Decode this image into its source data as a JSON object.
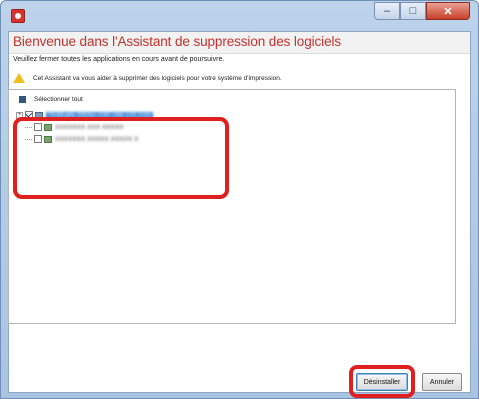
{
  "window": {
    "title": "",
    "caption_buttons": {
      "minimize": "–",
      "maximize": "□",
      "close": "✕"
    },
    "icon": "app-icon"
  },
  "wizard": {
    "heading": "Bienvenue dans l'Assistant de suppression des logiciels",
    "subtext": "Veuillez fermer toutes les applications en cours avant de poursuivre.",
    "info_icon": "warning-icon",
    "info_text": "Cet Assistant va vous aider à supprimer des logiciels pour votre système d'impression."
  },
  "list": {
    "select_all_label": "Sélectionner tout",
    "items": [
      {
        "label": "TASKalfa 2553ci (192.168.123.216)",
        "checked": true,
        "selected": true
      },
      {
        "label": "XXXXXXX XXX XXXXX",
        "checked": false,
        "selected": false
      },
      {
        "label": "XXXXXXX XXXXX XXXXX X",
        "checked": false,
        "selected": false
      }
    ]
  },
  "buttons": {
    "uninstall": "Désinstaller",
    "cancel": "Annuler"
  },
  "colors": {
    "heading": "#c3312c",
    "highlight": "#e0201e",
    "selection": "#3d86d6"
  }
}
